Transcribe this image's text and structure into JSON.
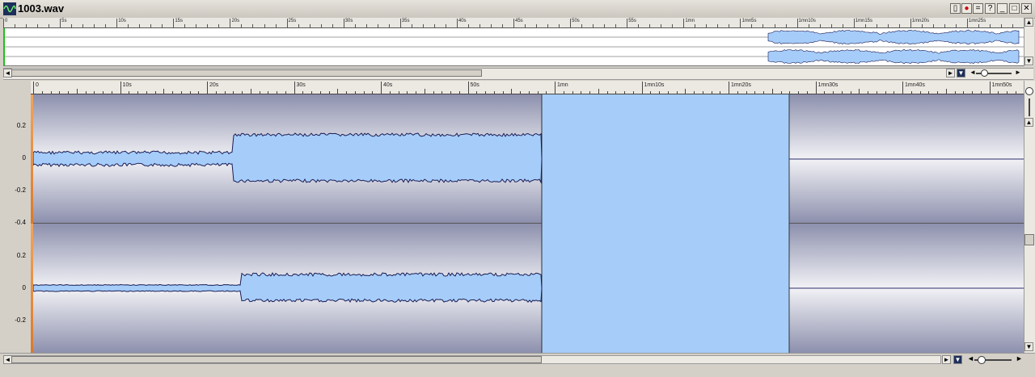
{
  "window": {
    "title": "1003.wav",
    "icon": "waveform-icon",
    "buttons": [
      "pin",
      "record",
      "minimize",
      "help",
      "minimize",
      "maximize",
      "close"
    ],
    "button_glyphs": [
      "▯",
      "●",
      "=",
      "?",
      "_",
      "□",
      "✕"
    ]
  },
  "overview": {
    "ruler_labels": [
      "0",
      "5s",
      "10s",
      "15s",
      "20s",
      "25s",
      "30s",
      "35s",
      "40s",
      "45s",
      "50s",
      "55s",
      "1mn",
      "1mn5s",
      "1mn10s",
      "1mn15s",
      "1mn20s",
      "1mn25s"
    ]
  },
  "main": {
    "ruler_labels": [
      "0",
      "10s",
      "20s",
      "30s",
      "40s",
      "50s",
      "1mn",
      "1mn10s",
      "1mn20s",
      "1mn30s",
      "1mn40s",
      "1mn50s"
    ],
    "y_labels_top": [
      "0.2",
      "0",
      "-0.2",
      "-0.4"
    ],
    "y_labels_bottom": [
      "0.2",
      "0",
      "-0.2"
    ],
    "selection_color": "#a6cdfa",
    "background_color": "#e6e6ee"
  },
  "controls": {
    "left_arrow": "◄",
    "right_arrow": "►",
    "down_arrow": "▼",
    "up_arrow": "▲",
    "zoom_minus": "◄",
    "zoom_plus": "►"
  }
}
